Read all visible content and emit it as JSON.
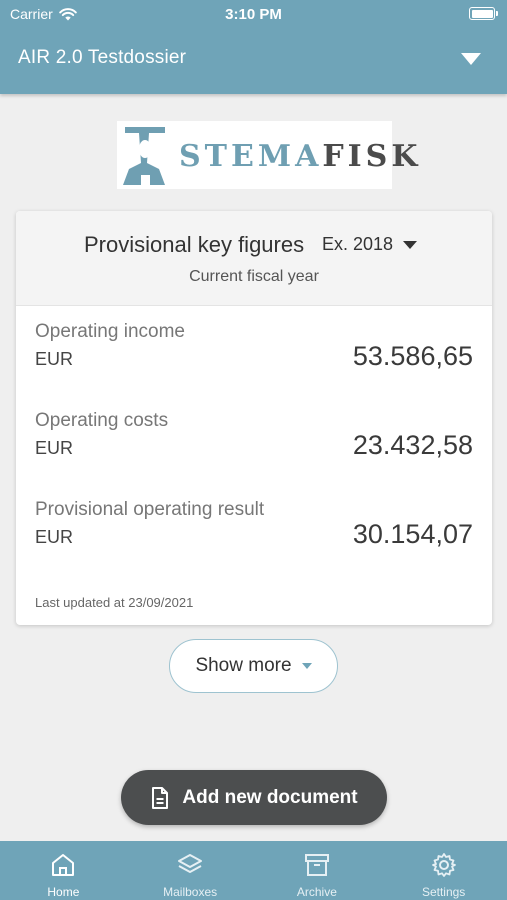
{
  "status_bar": {
    "carrier": "Carrier",
    "time": "3:10 PM"
  },
  "header": {
    "dossier_title": "AIR 2.0 Testdossier"
  },
  "logo": {
    "text_part1": "STEMA",
    "text_part2": "FISK"
  },
  "key_figures": {
    "title": "Provisional key figures",
    "fiscal_year_selected": "Ex. 2018",
    "subtitle": "Current fiscal year",
    "items": [
      {
        "label": "Operating income",
        "unit": "EUR",
        "value": "53.586,65"
      },
      {
        "label": "Operating costs",
        "unit": "EUR",
        "value": "23.432,58"
      },
      {
        "label": "Provisional operating result",
        "unit": "EUR",
        "value": "30.154,07"
      }
    ],
    "last_updated": "Last updated at 23/09/2021"
  },
  "show_more_label": "Show more",
  "add_document_label": "Add new document",
  "tabs": [
    {
      "label": "Home",
      "icon": "home-icon",
      "active": true
    },
    {
      "label": "Mailboxes",
      "icon": "layers-icon",
      "active": false
    },
    {
      "label": "Archive",
      "icon": "archive-icon",
      "active": false
    },
    {
      "label": "Settings",
      "icon": "gear-icon",
      "active": false
    }
  ],
  "colors": {
    "accent": "#6fa4b8",
    "fab": "#4c4e4f"
  }
}
